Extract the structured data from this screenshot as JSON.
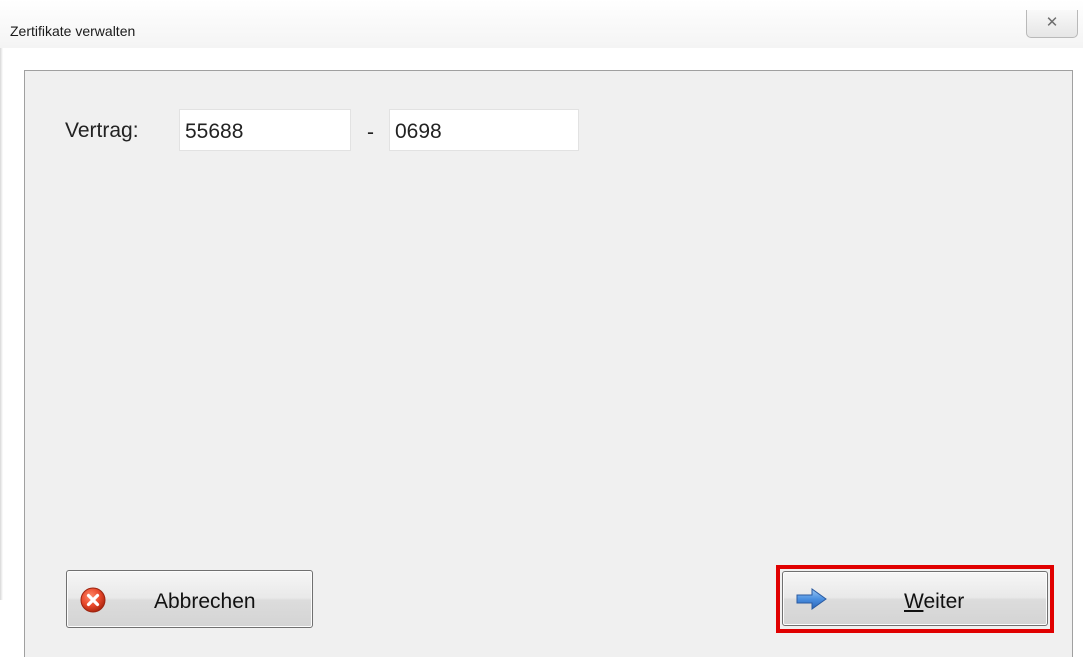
{
  "window": {
    "title": "Zertifikate verwalten",
    "close_glyph": "✕"
  },
  "form": {
    "vertrag_label": "Vertrag:",
    "separator": "-",
    "field1_value": "55688",
    "field2_value": "0698"
  },
  "buttons": {
    "cancel_label": "Abbrechen",
    "cancel_icon": "cancel-icon",
    "next_mnemonic": "W",
    "next_label_rest": "eiter",
    "next_icon": "arrow-right-icon"
  },
  "colors": {
    "highlight": "#e00000",
    "cancel_icon": "#e8492c",
    "arrow_icon": "#3b7fd6"
  }
}
